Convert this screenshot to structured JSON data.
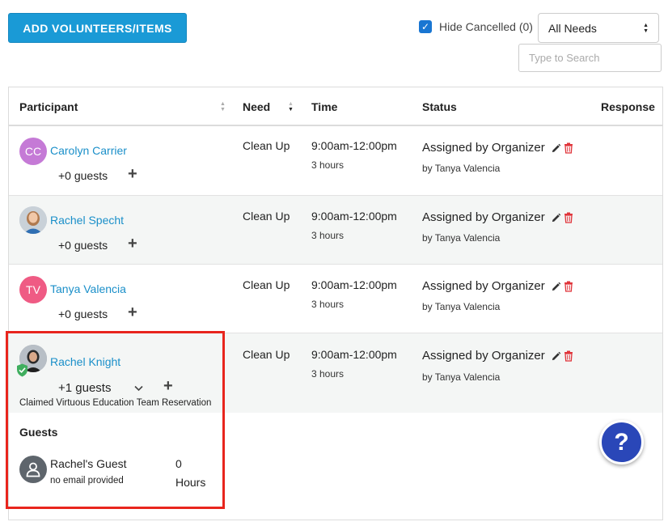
{
  "toolbar": {
    "add_label": "ADD VOLUNTEERS/ITEMS",
    "hide_cancelled_label": "Hide Cancelled (0)",
    "needs_filter_value": "All Needs",
    "search_placeholder": "Type to Search"
  },
  "columns": {
    "participant": "Participant",
    "need": "Need",
    "time": "Time",
    "status": "Status",
    "response": "Response"
  },
  "rows": [
    {
      "initials": "CC",
      "avatar_color": "#c57ad6",
      "name": "Carolyn Carrier",
      "guests": "+0 guests",
      "need": "Clean Up",
      "time": "9:00am-12:00pm",
      "duration": "3 hours",
      "status": "Assigned by Organizer",
      "by": "by Tanya Valencia"
    },
    {
      "initials": "",
      "avatar_color": "#9aa3ad",
      "name": "Rachel Specht",
      "guests": "+0 guests",
      "need": "Clean Up",
      "time": "9:00am-12:00pm",
      "duration": "3 hours",
      "status": "Assigned by Organizer",
      "by": "by Tanya Valencia"
    },
    {
      "initials": "TV",
      "avatar_color": "#ef5b84",
      "name": "Tanya Valencia",
      "guests": "+0 guests",
      "need": "Clean Up",
      "time": "9:00am-12:00pm",
      "duration": "3 hours",
      "status": "Assigned by Organizer",
      "by": "by Tanya Valencia"
    },
    {
      "initials": "",
      "avatar_color": "#8d949b",
      "name": "Rachel Knight",
      "guests": "+1 guests",
      "claimed": "Claimed Virtuous Education Team Reservation",
      "need": "Clean Up",
      "time": "9:00am-12:00pm",
      "duration": "3 hours",
      "status": "Assigned by Organizer",
      "by": "by Tanya Valencia"
    }
  ],
  "guests_section": {
    "title": "Guests",
    "guest_name": "Rachel's Guest",
    "guest_email": "no email provided",
    "hours_value": "0",
    "hours_label": "Hours"
  },
  "help": {
    "label": "?"
  },
  "colors": {
    "accent": "#1a9ad6",
    "link": "#1a8fc9",
    "delete": "#e0343a",
    "highlight": "#e8251d",
    "help": "#2a47b8"
  }
}
